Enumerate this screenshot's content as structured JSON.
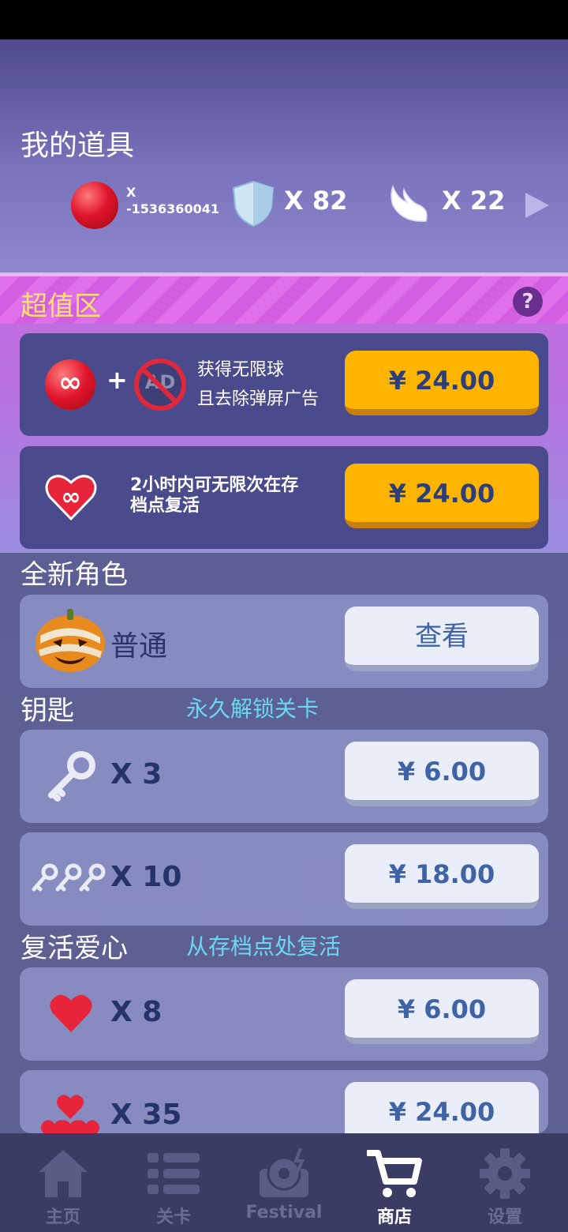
{
  "header": {
    "title": "我的道具",
    "ball": {
      "prefix": "X",
      "count": "-1536360041"
    },
    "shield": {
      "count": "X 82"
    },
    "wing": {
      "count": "X 22"
    }
  },
  "deals": {
    "title": "超值区",
    "help": "?",
    "card1": {
      "plus": "+",
      "ad_text": "AD",
      "line1": "获得无限球",
      "line2": "且去除弹屏广告",
      "price": "¥ 24.00"
    },
    "card2": {
      "line1": "2小时内可无限次在存",
      "line2": "档点复活",
      "price": "¥ 24.00"
    }
  },
  "characters": {
    "title": "全新角色",
    "item": {
      "label": "普通",
      "button": "查看"
    }
  },
  "keys": {
    "title": "钥匙",
    "subtitle": "永久解锁关卡",
    "items": [
      {
        "label": "X 3",
        "price": "¥ 6.00"
      },
      {
        "label": "X 10",
        "price": "¥ 18.00"
      }
    ]
  },
  "hearts": {
    "title": "复活爱心",
    "subtitle": "从存档点处复活",
    "items": [
      {
        "label": "X 8",
        "price": "¥ 6.00"
      },
      {
        "label": "X 35",
        "price": "¥ 24.00"
      }
    ]
  },
  "tabs": [
    {
      "label": "主页",
      "icon": "home-icon"
    },
    {
      "label": "关卡",
      "icon": "list-icon"
    },
    {
      "label": "Festival",
      "icon": "festival-icon"
    },
    {
      "label": "商店",
      "icon": "cart-icon",
      "active": true
    },
    {
      "label": "设置",
      "icon": "gear-icon"
    }
  ],
  "colors": {
    "price_orange": "#ffb400",
    "subtitle_cyan": "#6ad8f0",
    "deal_title": "#ffe36a"
  }
}
